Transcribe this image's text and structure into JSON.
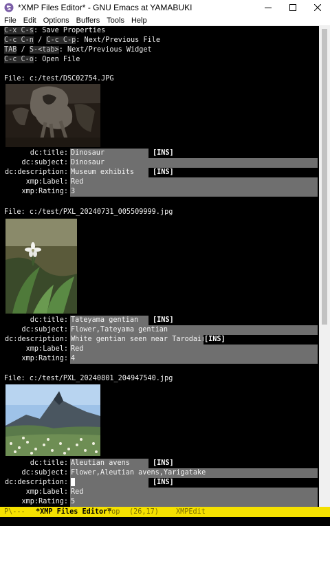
{
  "window": {
    "title": "*XMP Files Editor* - GNU Emacs at YAMABUKI"
  },
  "menu": [
    "File",
    "Edit",
    "Options",
    "Buffers",
    "Tools",
    "Help"
  ],
  "help": [
    {
      "keys": "C-x C-s",
      "text": ": Save Properties"
    },
    {
      "keys1": "C-c C-n",
      "sep": " / ",
      "keys2": "C-c C-p",
      "text": ": Next/Previous File"
    },
    {
      "keys1": "TAB",
      "sep": " / ",
      "keys2": "S-<tab>",
      "text": ": Next/Previous Widget"
    },
    {
      "keys": "C-c C-o",
      "text": ": Open File"
    }
  ],
  "files": [
    {
      "path": "File: c:/test/DSC02754.JPG",
      "fields": [
        {
          "label": "dc:title:",
          "value": "Dinosaur",
          "ins": "[INS]"
        },
        {
          "label": "dc:subject:",
          "value": "Dinosaur"
        },
        {
          "label": "dc:description:",
          "value": "Museum exhibits",
          "ins": "[INS]"
        },
        {
          "label": "xmp:Label:",
          "value": "Red"
        },
        {
          "label": "xmp:Rating:",
          "value": "3"
        }
      ]
    },
    {
      "path": "File: c:/test/PXL_20240731_005509999.jpg",
      "fields": [
        {
          "label": "dc:title:",
          "value": "Tateyama gentian",
          "ins": "[INS]"
        },
        {
          "label": "dc:subject:",
          "value": "Flower,Tateyama gentian"
        },
        {
          "label": "dc:description:",
          "value": "White gentian seen near Tarodaira",
          "ins": "[INS]"
        },
        {
          "label": "xmp:Label:",
          "value": "Red"
        },
        {
          "label": "xmp:Rating:",
          "value": "4"
        }
      ]
    },
    {
      "path": "File: c:/test/PXL_20240801_204947540.jpg",
      "fields": [
        {
          "label": "dc:title:",
          "value": "Aleutian avens",
          "ins": "[INS]"
        },
        {
          "label": "dc:subject:",
          "value": "Flower,Aleutian avens,Yarigatake"
        },
        {
          "label": "dc:description:",
          "value": "",
          "ins": "[INS]"
        },
        {
          "label": "xmp:Label:",
          "value": "Red"
        },
        {
          "label": "xmp:Rating:",
          "value": "5"
        }
      ]
    }
  ],
  "modeline": {
    "status": "P\\---",
    "buffer": "*XMP Files Editor*",
    "position": "Top",
    "linecol": "(26,17)",
    "mode": "XMPEdit",
    "mode_icon": "gear-icon"
  },
  "colors": {
    "modeline_bg": "#f5e100",
    "field_bg": "#6f6f6f",
    "buffer_bg": "#000000"
  }
}
